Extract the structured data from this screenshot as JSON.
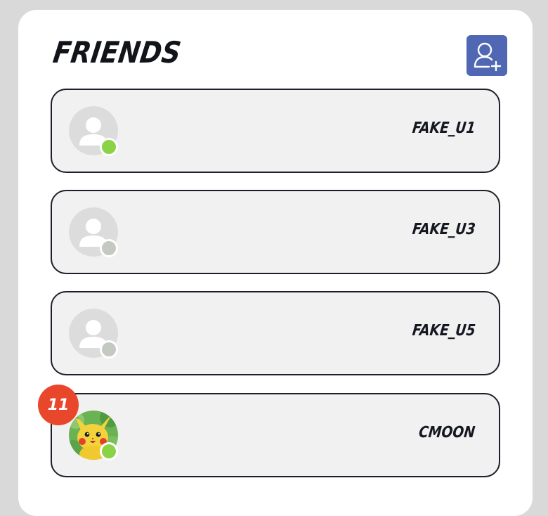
{
  "title": "FRIENDS",
  "add_friend_icon": "add-user-icon",
  "colors": {
    "accent": "#5068b3",
    "online": "#8ad346",
    "offline": "#c4c9c1",
    "badge": "#e8472b"
  },
  "friends": [
    {
      "name": "FAKE_U1",
      "status": "online",
      "avatar": "default-avatar-icon"
    },
    {
      "name": "FAKE_U3",
      "status": "offline",
      "avatar": "default-avatar-icon"
    },
    {
      "name": "FAKE_U5",
      "status": "offline",
      "avatar": "default-avatar-icon"
    },
    {
      "name": "CMOON",
      "status": "online",
      "avatar": "pikachu-avatar",
      "unread": "11"
    }
  ]
}
